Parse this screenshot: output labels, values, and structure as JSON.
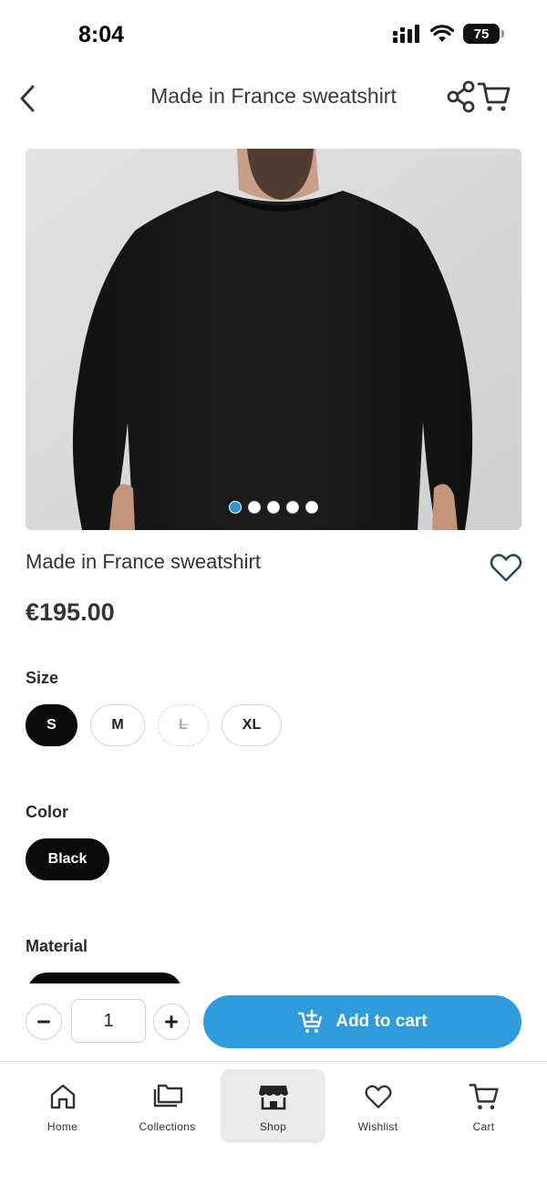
{
  "status_bar": {
    "time": "8:04",
    "battery": "75"
  },
  "header": {
    "title": "Made in France sweatshirt"
  },
  "gallery": {
    "image_count": 5,
    "active_index": 0
  },
  "product": {
    "title": "Made in France sweatshirt",
    "price": "€195.00"
  },
  "options": {
    "size_label": "Size",
    "sizes": [
      {
        "label": "S",
        "state": "selected"
      },
      {
        "label": "M",
        "state": "available"
      },
      {
        "label": "L",
        "state": "unavailable"
      },
      {
        "label": "XL",
        "state": "available"
      }
    ],
    "color_label": "Color",
    "color_value": "Black",
    "material_label": "Material"
  },
  "purchase": {
    "quantity": "1",
    "add_to_cart_label": "Add to cart"
  },
  "tabs": [
    {
      "label": "Home",
      "icon": "home-icon"
    },
    {
      "label": "Collections",
      "icon": "collections-icon"
    },
    {
      "label": "Shop",
      "icon": "shop-icon",
      "active": true
    },
    {
      "label": "Wishlist",
      "icon": "heart-icon"
    },
    {
      "label": "Cart",
      "icon": "cart-icon"
    }
  ],
  "colors": {
    "accent": "#2e9bdc",
    "dot_active": "#2e95d8",
    "selected_chip": "#0a0a0a"
  }
}
